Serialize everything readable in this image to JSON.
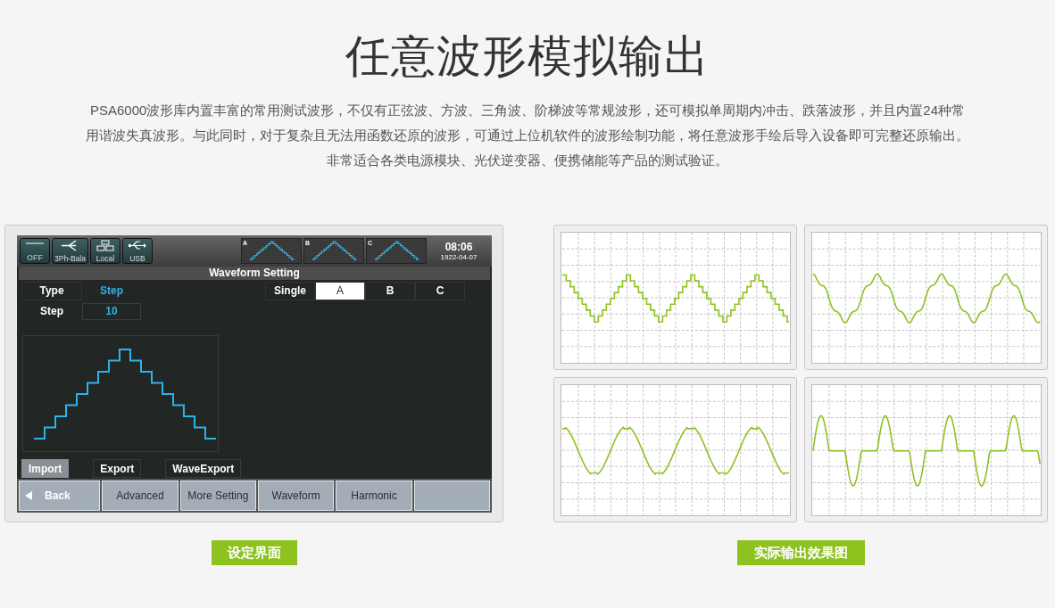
{
  "title": "任意波形模拟输出",
  "description": [
    "PSA6000波形库内置丰富的常用测试波形，不仅有正弦波、方波、三角波、阶梯波等常规波形，还可模拟单周期内冲击、跌落波形，并且内置24种常",
    "用谐波失真波形。与此同时，对于复杂且无法用函数还原的波形，可通过上位机软件的波形绘制功能，将任意波形手绘后导入设备即可完整还原输出。",
    "非常适合各类电源模块、光伏逆变器、便携储能等产品的测试验证。"
  ],
  "device": {
    "status_icons": [
      {
        "kind": "power",
        "label": "OFF"
      },
      {
        "kind": "phase",
        "label": "3Ph-Bala"
      },
      {
        "kind": "local",
        "label": "Local"
      },
      {
        "kind": "usb",
        "label": "USB"
      }
    ],
    "phases": [
      {
        "label": "A"
      },
      {
        "label": "B"
      },
      {
        "label": "C"
      }
    ],
    "time": "08:06",
    "date": "1922-04-07",
    "panel_title": "Waveform Setting",
    "type_label": "Type",
    "type_value": "Step",
    "step_label": "Step",
    "step_value": "10",
    "channel_label": "Single",
    "channels": [
      {
        "label": "A",
        "selected": true
      },
      {
        "label": "B",
        "selected": false
      },
      {
        "label": "C",
        "selected": false
      }
    ],
    "actions": [
      {
        "label": "Import",
        "selected": true
      },
      {
        "label": "Export",
        "selected": false
      },
      {
        "label": "WaveExport",
        "selected": false
      }
    ],
    "softkeys": [
      {
        "kind": "back",
        "label": "Back"
      },
      {
        "kind": "plain",
        "label": "Advanced"
      },
      {
        "kind": "plain",
        "label": "More Setting"
      },
      {
        "kind": "plain",
        "label": "Waveform"
      },
      {
        "kind": "plain",
        "label": "Harmonic"
      },
      {
        "kind": "blank"
      }
    ]
  },
  "scope_plots": [
    {
      "kind": "stepped-triangle"
    },
    {
      "kind": "harmonic-sine"
    },
    {
      "kind": "notched-sine"
    },
    {
      "kind": "pulsed-sine"
    }
  ],
  "captions": [
    "设定界面",
    "实际输出效果图"
  ]
}
